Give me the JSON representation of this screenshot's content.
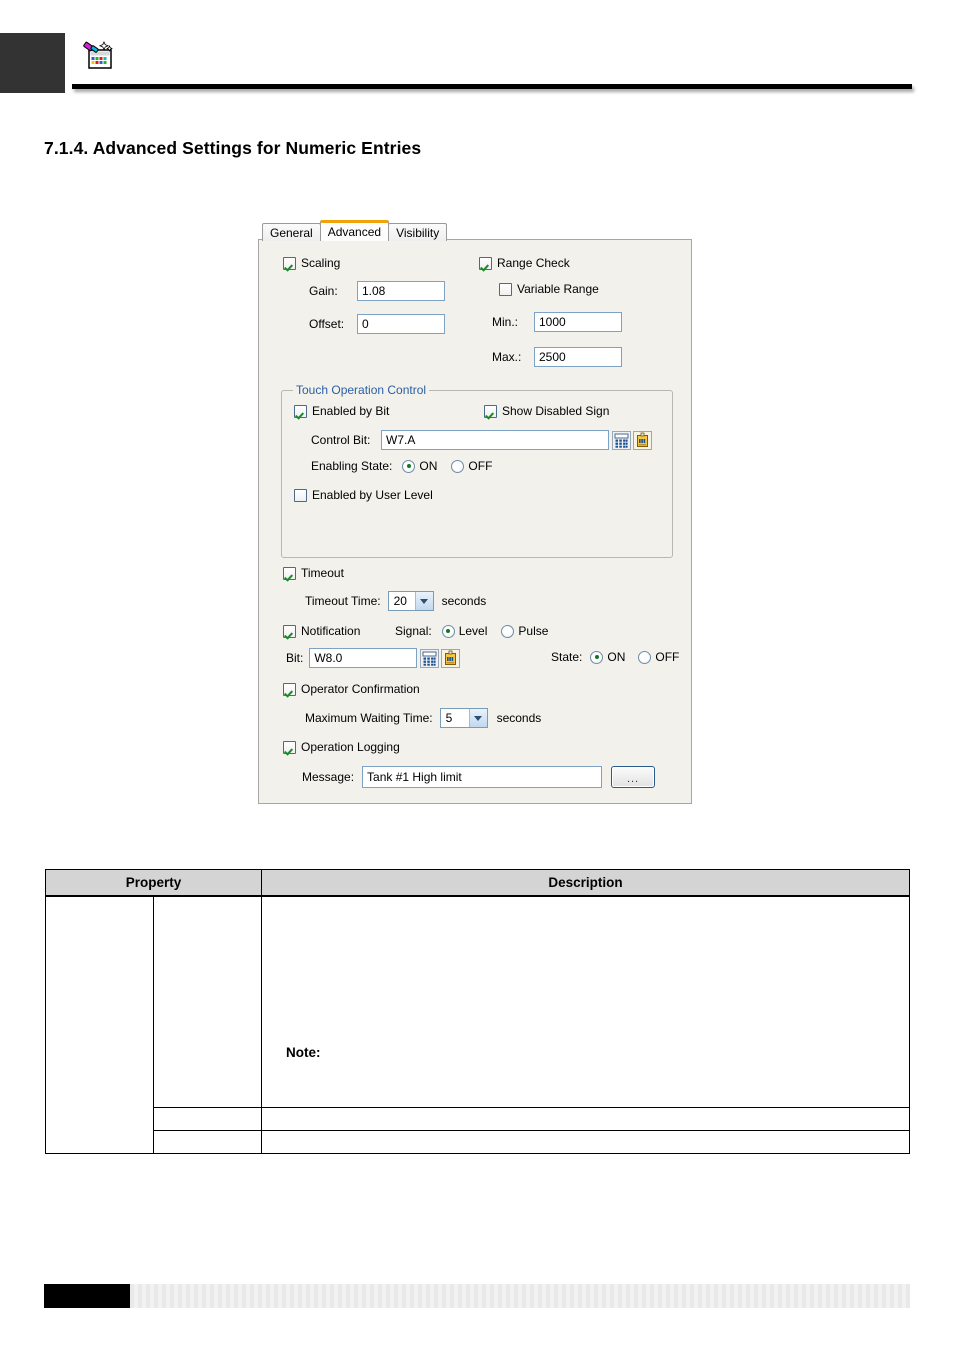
{
  "header": {
    "icon": "paint-palette-window-icon",
    "black_box": "header-marker"
  },
  "section": {
    "heading": "7.1.4. Advanced Settings for Numeric Entries"
  },
  "dialog": {
    "tabs": [
      {
        "label": "General",
        "selected": false
      },
      {
        "label": "Advanced",
        "selected": true
      },
      {
        "label": "Visibility",
        "selected": false
      }
    ],
    "accent_selected_tab": "#f0a30a",
    "scaling": {
      "checkbox_label": "Scaling",
      "checked": true,
      "gain_label": "Gain:",
      "gain_value": "1.08",
      "offset_label": "Offset:",
      "offset_value": "0"
    },
    "range_check": {
      "checkbox_label": "Range Check",
      "checked": true,
      "variable_range_label": "Variable Range",
      "variable_range_checked": false,
      "min_label": "Min.:",
      "min_value": "1000",
      "max_label": "Max.:",
      "max_value": "2500"
    },
    "touch_operation_control": {
      "legend": "Touch Operation Control",
      "legend_color": "#2a5fa5",
      "enabled_by_bit_label": "Enabled by Bit",
      "enabled_by_bit_checked": true,
      "show_disabled_sign_label": "Show Disabled Sign",
      "show_disabled_sign_checked": true,
      "control_bit_label": "Control Bit:",
      "control_bit_value": "W7.A",
      "enabling_state_label": "Enabling State:",
      "enabling_state_on": "ON",
      "enabling_state_off": "OFF",
      "enabling_state_selected": "ON",
      "enabled_by_user_level_label": "Enabled by User Level",
      "enabled_by_user_level_checked": false,
      "keypad_icon": "keypad-icon",
      "tag_icon": "tag-icon"
    },
    "timeout": {
      "checkbox_label": "Timeout",
      "checked": true,
      "time_label": "Timeout Time:",
      "time_value": "20",
      "unit": "seconds"
    },
    "notification": {
      "checkbox_label": "Notification",
      "checked": true,
      "signal_label": "Signal:",
      "signal_level": "Level",
      "signal_pulse": "Pulse",
      "signal_selected": "Level",
      "bit_label": "Bit:",
      "bit_value": "W8.0",
      "state_label": "State:",
      "state_on": "ON",
      "state_off": "OFF",
      "state_selected": "ON",
      "keypad_icon": "keypad-icon",
      "tag_icon": "tag-icon"
    },
    "operator_confirmation": {
      "checkbox_label": "Operator Confirmation",
      "checked": true,
      "max_wait_label": "Maximum Waiting Time:",
      "max_wait_value": "5",
      "unit": "seconds"
    },
    "operation_logging": {
      "checkbox_label": "Operation Logging",
      "checked": true,
      "message_label": "Message:",
      "message_value": "Tank #1 High limit",
      "browse_button_label": "..."
    }
  },
  "property_table": {
    "headers": {
      "property": "Property",
      "description": "Description"
    },
    "rows": [
      {
        "col1": "",
        "col2": "",
        "description": "",
        "note_label": "Note:"
      },
      {
        "col1": "",
        "col2": "",
        "description": ""
      },
      {
        "col1": "",
        "col2": "",
        "description": ""
      }
    ]
  },
  "footer": {
    "black_block": "footer-marker",
    "bar": "footer-pattern-bar"
  }
}
